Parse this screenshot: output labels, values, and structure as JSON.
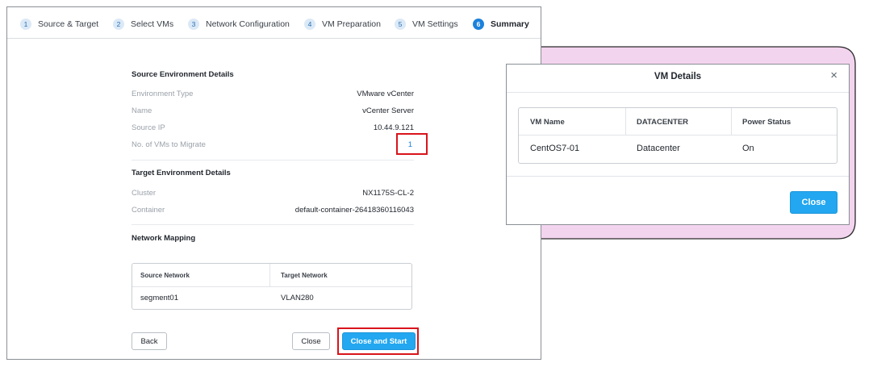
{
  "wizard": {
    "steps": [
      {
        "num": "1",
        "label": "Source & Target"
      },
      {
        "num": "2",
        "label": "Select VMs"
      },
      {
        "num": "3",
        "label": "Network Configuration"
      },
      {
        "num": "4",
        "label": "VM Preparation"
      },
      {
        "num": "5",
        "label": "VM Settings"
      },
      {
        "num": "6",
        "label": "Summary",
        "active": true
      }
    ]
  },
  "source": {
    "title": "Source Environment Details",
    "env_type_label": "Environment Type",
    "env_type_value": "VMware vCenter",
    "name_label": "Name",
    "name_value": "vCenter Server",
    "ip_label": "Source IP",
    "ip_value": "10.44.9.121",
    "vm_count_label": "No. of VMs to Migrate",
    "vm_count_value": "1"
  },
  "target": {
    "title": "Target Environment Details",
    "cluster_label": "Cluster",
    "cluster_value": "NX1175S-CL-2",
    "container_label": "Container",
    "container_value": "default-container-26418360116043"
  },
  "network": {
    "title": "Network Mapping",
    "columns": [
      "Source Network",
      "Target Network"
    ],
    "rows": [
      [
        "segment01",
        "VLAN280"
      ]
    ]
  },
  "footer": {
    "back": "Back",
    "close": "Close",
    "close_and_start": "Close and Start"
  },
  "modal": {
    "title": "VM Details",
    "close_icon": "×",
    "columns": [
      "VM Name",
      "DATACENTER",
      "Power Status"
    ],
    "rows": [
      [
        "CentOS7-01",
        "Datacenter",
        "On"
      ]
    ],
    "close_button": "Close"
  },
  "colors": {
    "accent": "#1b82dc",
    "primary_button": "#22a7f0",
    "highlight": "#d9141b",
    "callout_fill": "#f3d4ef",
    "callout_stroke": "#2b2b2b"
  }
}
